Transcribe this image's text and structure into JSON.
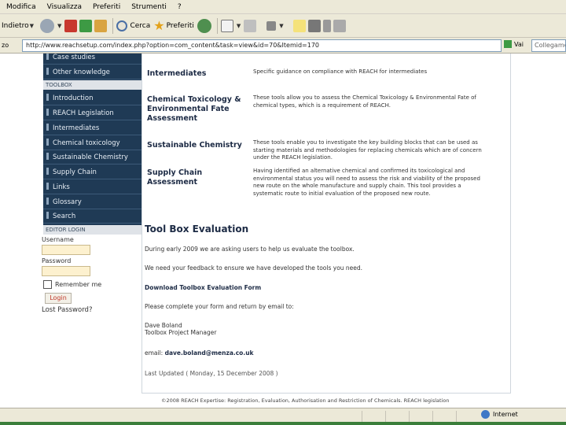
{
  "menu": [
    "Modifica",
    "Visualizza",
    "Preferiti",
    "Strumenti",
    "?"
  ],
  "toolbar": {
    "back_label": "Indietro",
    "search_label": "Cerca",
    "favorites_label": "Preferiti"
  },
  "address": {
    "left_label": "zo",
    "url": "http://www.reachsetup.com/index.php?option=com_content&task=view&id=70&Itemid=170",
    "go_label": "Vai",
    "links_label": "Collegamenti"
  },
  "sidebar": {
    "top_items": [
      "Case studies",
      "Other knowledge"
    ],
    "toolbox_header": "TOOLBOX",
    "toolbox_items": [
      "Introduction",
      "REACH Legislation",
      "Intermediates",
      "Chemical toxicology",
      "Sustainable Chemistry",
      "Supply Chain",
      "Links",
      "Glossary",
      "Search"
    ],
    "editor_header": "EDITOR LOGIN"
  },
  "login": {
    "username_label": "Username",
    "password_label": "Password",
    "remember_label": "Remember me",
    "login_button": "Login",
    "lost_password": "Lost Password?"
  },
  "tools": [
    {
      "name": "Intermediates",
      "desc": "Specific guidance on compliance with REACH for intermediates"
    },
    {
      "name": "Chemical Toxicology & Environmental Fate Assessment",
      "desc": "These tools allow you to assess the Chemical Toxicology & Environmental Fate of chemical types, which is a requirement of REACH."
    },
    {
      "name": "Sustainable Chemistry",
      "desc": "These tools enable you to investigate the key building blocks that can be used as starting materials and methodologies for replacing chemicals which are of concern under the REACH legislation."
    },
    {
      "name": "Supply Chain Assessment",
      "desc": "Having identified an alternative chemical and confirmed its toxicological and environmental status you will need to assess the risk and viability of the proposed new route on the whole manufacture and supply chain. This tool provides a systematic route to initial evaluation of the proposed new route."
    }
  ],
  "evaluation": {
    "title": "Tool Box Evaluation",
    "p1": "During early 2009 we are asking users to help us evaluate the toolbox.",
    "p2": "We need your feedback to ensure we have developed the tools you need.",
    "download": "Download Toolbox Evaluation Form",
    "p3": "Please complete your form and return by email to:",
    "contact_name": "Dave Boland",
    "contact_role": "Toolbox Project Manager",
    "email_prefix": "email:",
    "email": "dave.boland@menza.co.uk",
    "last_updated": "Last Updated ( Monday, 15 December 2008 )"
  },
  "footer": "©2008 REACH Expertise: Registration, Evaluation, Authorisation and Restriction of Chemicals. REACH legislation",
  "status": {
    "zone": "Internet"
  },
  "colors": {
    "sidebar_bg": "#1f3a55",
    "input_bg": "#fdf1cf",
    "login_text": "#c0392b",
    "heading": "#1d2b45"
  }
}
